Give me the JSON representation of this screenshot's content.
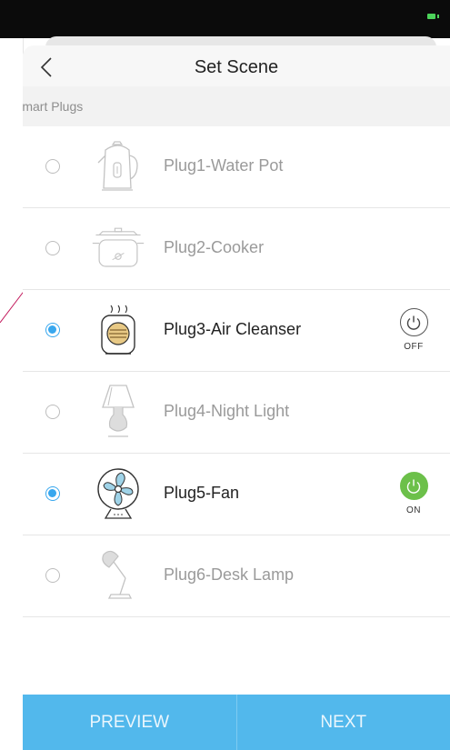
{
  "header": {
    "title": "Set Scene"
  },
  "section": {
    "label": "Smart Plugs"
  },
  "plugs": [
    {
      "name": "Plug1-Water Pot",
      "icon": "water-pot-icon",
      "selected": false
    },
    {
      "name": "Plug2-Cooker",
      "icon": "cooker-icon",
      "selected": false
    },
    {
      "name": "Plug3-Air Cleanser",
      "icon": "air-cleanser-icon",
      "selected": true,
      "power": "OFF"
    },
    {
      "name": "Plug4-Night Light",
      "icon": "night-light-icon",
      "selected": false
    },
    {
      "name": "Plug5-Fan",
      "icon": "fan-icon",
      "selected": true,
      "power": "ON"
    },
    {
      "name": "Plug6-Desk Lamp",
      "icon": "desk-lamp-icon",
      "selected": false
    }
  ],
  "footer": {
    "preview_label": "PREVIEW",
    "next_label": "NEXT"
  },
  "colors": {
    "accent": "#38a7ee",
    "footer": "#52b8ec",
    "on": "#6cc04a"
  }
}
